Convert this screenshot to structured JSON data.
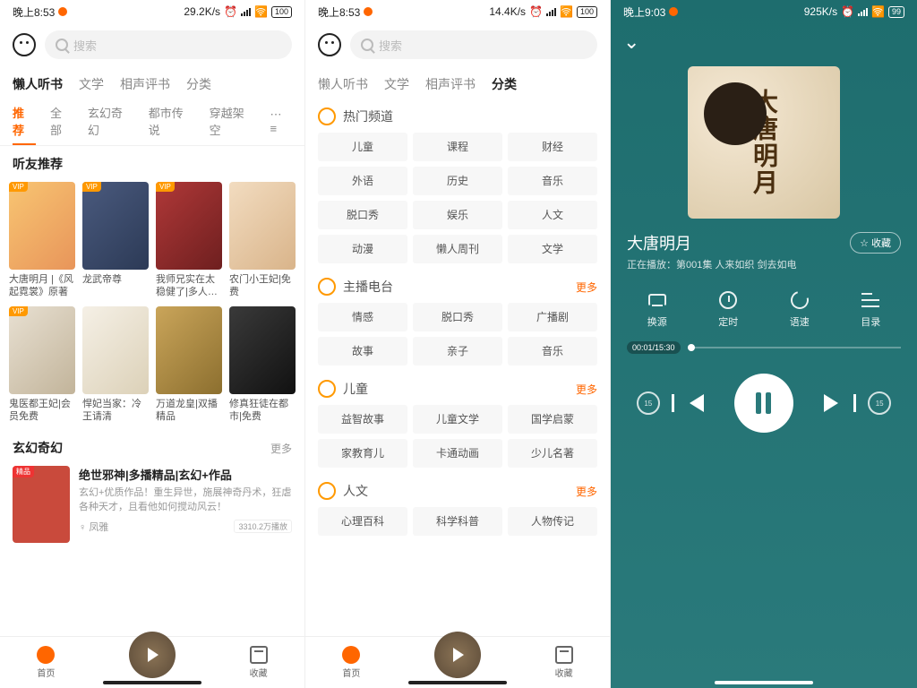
{
  "status": {
    "a": {
      "time": "晚上8:53",
      "speed": "29.2K/s",
      "batt": "100"
    },
    "b": {
      "time": "晚上8:53",
      "speed": "14.4K/s",
      "batt": "100"
    },
    "c": {
      "time": "晚上9:03",
      "speed": "925K/s",
      "batt": "99"
    }
  },
  "search": {
    "placeholder": "搜索"
  },
  "main_tabs": [
    "懒人听书",
    "文学",
    "相声评书",
    "分类"
  ],
  "sub_tabs": [
    "推荐",
    "全部",
    "玄幻奇幻",
    "都市传说",
    "穿越架空"
  ],
  "sections": {
    "recommend": "听友推荐",
    "fantasy": "玄幻奇幻",
    "more": "更多"
  },
  "books_row1": [
    {
      "title": "大唐明月 |《风起霓裳》原著",
      "badge": "VIP"
    },
    {
      "title": "龙武帝尊",
      "badge": "VIP"
    },
    {
      "title": "我师兄实在太稳健了|多人…",
      "badge": "VIP"
    },
    {
      "title": "农门小王妃|免费",
      "badge": ""
    }
  ],
  "books_row2": [
    {
      "title": "鬼医都王妃|会员免费",
      "badge": "VIP"
    },
    {
      "title": "悍妃当家：冷王请清",
      "badge": ""
    },
    {
      "title": "万道龙皇|双播精品",
      "badge": ""
    },
    {
      "title": "修真狂徒在都市|免费",
      "badge": ""
    }
  ],
  "feat": {
    "tag": "精品",
    "title": "绝世邪神|多播精品|玄幻+作品",
    "desc": "玄幻+优质作品！重生异世，施展神奇丹术，狂虐各种天才，且看他如何搅动风云！",
    "author": "凤雅",
    "plays": "3310.2万播放"
  },
  "nav": {
    "home": "首页",
    "fav": "收藏"
  },
  "cats": {
    "hot": {
      "label": "热门频道",
      "items": [
        "儿童",
        "课程",
        "财经",
        "外语",
        "历史",
        "音乐",
        "脱口秀",
        "娱乐",
        "人文",
        "动漫",
        "懒人周刊",
        "文学"
      ]
    },
    "radio": {
      "label": "主播电台",
      "more": "更多",
      "items": [
        "情感",
        "脱口秀",
        "广播剧",
        "故事",
        "亲子",
        "音乐"
      ]
    },
    "kids": {
      "label": "儿童",
      "more": "更多",
      "items": [
        "益智故事",
        "儿童文学",
        "国学启蒙",
        "家教育儿",
        "卡通动画",
        "少儿名著"
      ]
    },
    "human": {
      "label": "人文",
      "more": "更多",
      "items": [
        "心理百科",
        "科学科普",
        "人物传记"
      ]
    }
  },
  "player": {
    "title": "大唐明月",
    "sub": "正在播放：第001集 人来如织 剑去如电",
    "fav": "收藏",
    "ctrls": [
      "换源",
      "定时",
      "语速",
      "目录"
    ],
    "time": "00:01/15:30",
    "skip": "15",
    "art": "大唐明月"
  }
}
